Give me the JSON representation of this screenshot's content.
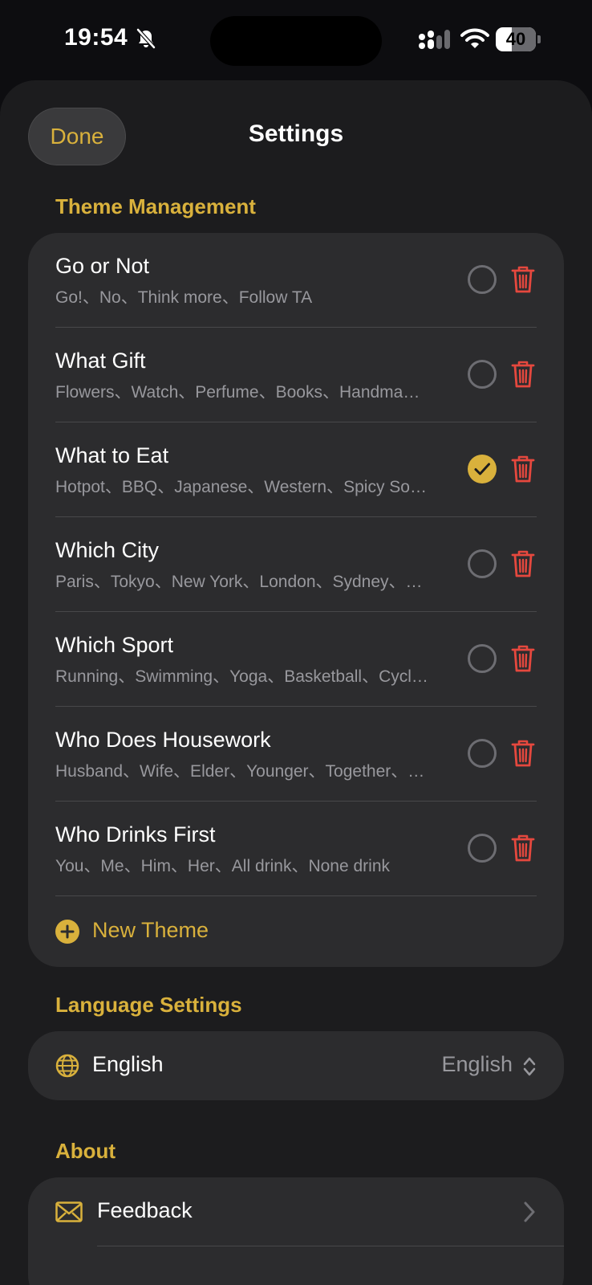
{
  "status_bar": {
    "time": "19:54",
    "battery": "40",
    "battery_fraction": 0.4
  },
  "header": {
    "done_label": "Done",
    "title": "Settings"
  },
  "theme_section": {
    "title": "Theme Management",
    "themes": [
      {
        "name": "Go or Not",
        "options": "Go!、No、Think more、Follow TA",
        "selected": false
      },
      {
        "name": "What Gift",
        "options": "Flowers、Watch、Perfume、Books、Handma…",
        "selected": false
      },
      {
        "name": "What to Eat",
        "options": "Hotpot、BBQ、Japanese、Western、Spicy So…",
        "selected": true
      },
      {
        "name": "Which City",
        "options": "Paris、Tokyo、New York、London、Sydney、…",
        "selected": false
      },
      {
        "name": "Which Sport",
        "options": "Running、Swimming、Yoga、Basketball、Cycl…",
        "selected": false
      },
      {
        "name": "Who Does Housework",
        "options": "Husband、Wife、Elder、Younger、Together、…",
        "selected": false
      },
      {
        "name": "Who Drinks First",
        "options": "You、Me、Him、Her、All drink、None drink",
        "selected": false
      }
    ],
    "new_theme_label": "New Theme"
  },
  "language_section": {
    "title": "Language Settings",
    "label": "English",
    "selected_value": "English"
  },
  "about_section": {
    "title": "About",
    "feedback_label": "Feedback"
  },
  "colors": {
    "accent": "#d9b13c",
    "delete": "#e5483e",
    "card": "#2c2c2e",
    "sheet": "#1c1c1e",
    "secondary_text": "#98989d"
  }
}
